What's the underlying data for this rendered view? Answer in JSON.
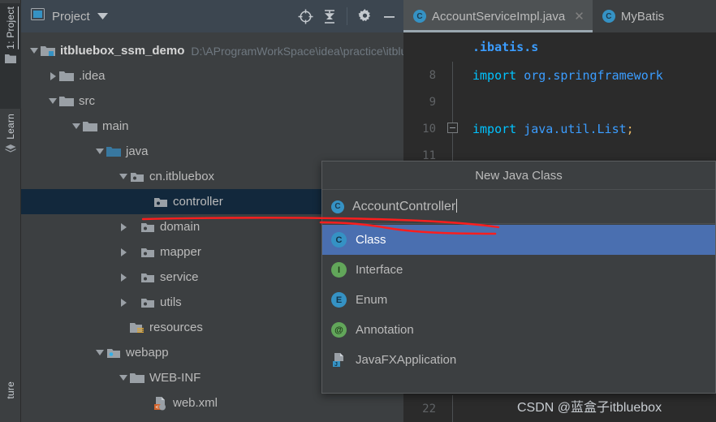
{
  "tool_strip": {
    "tabs": [
      {
        "label": "1: Project",
        "icon": "project-folder-icon"
      },
      {
        "label": "Learn",
        "icon": "learn-book-icon"
      },
      {
        "label": "ture",
        "icon": "structure-icon"
      }
    ]
  },
  "panel": {
    "title": "Project",
    "dropdown_icon": "chevron-down-icon",
    "window_icon": "project-window-icon",
    "actions": [
      {
        "name": "locate-icon",
        "tooltip": "Select Opened File"
      },
      {
        "name": "collapse-all-icon",
        "tooltip": "Collapse All"
      },
      {
        "name": "gear-icon",
        "tooltip": "Settings"
      },
      {
        "name": "minimize-icon",
        "tooltip": "Hide"
      }
    ]
  },
  "tree": {
    "rows": [
      {
        "label": "itbluebox_ssm_demo",
        "path": "D:\\AProgramWorkSpace\\idea\\practice\\itbluebox_ssm_demo",
        "indent": 0,
        "arrow": "down",
        "icon": "module-folder-icon",
        "bold": true,
        "selected": false
      },
      {
        "label": ".idea",
        "path": "",
        "indent": 1,
        "arrow": "right",
        "icon": "folder-icon",
        "bold": false,
        "selected": false
      },
      {
        "label": "src",
        "path": "",
        "indent": 1,
        "arrow": "down",
        "icon": "folder-icon",
        "bold": false,
        "selected": false
      },
      {
        "label": "main",
        "path": "",
        "indent": 2,
        "arrow": "down",
        "icon": "folder-icon",
        "bold": false,
        "selected": false
      },
      {
        "label": "java",
        "path": "",
        "indent": 3,
        "arrow": "down",
        "icon": "source-root-folder-icon",
        "bold": false,
        "selected": false
      },
      {
        "label": "cn.itbluebox",
        "path": "",
        "indent": 4,
        "arrow": "down",
        "icon": "package-folder-icon",
        "bold": false,
        "selected": false
      },
      {
        "label": "controller",
        "path": "",
        "indent": 5,
        "arrow": "none",
        "icon": "package-folder-icon",
        "bold": false,
        "selected": true
      },
      {
        "label": "domain",
        "path": "",
        "indent": 5,
        "arrow": "right",
        "icon": "package-folder-icon",
        "bold": false,
        "selected": false
      },
      {
        "label": "mapper",
        "path": "",
        "indent": 5,
        "arrow": "right",
        "icon": "package-folder-icon",
        "bold": false,
        "selected": false
      },
      {
        "label": "service",
        "path": "",
        "indent": 5,
        "arrow": "right",
        "icon": "package-folder-icon",
        "bold": false,
        "selected": false
      },
      {
        "label": "utils",
        "path": "",
        "indent": 5,
        "arrow": "right",
        "icon": "package-folder-icon",
        "bold": false,
        "selected": false
      },
      {
        "label": "resources",
        "path": "",
        "indent": 4,
        "arrow": "none",
        "icon": "resources-folder-icon",
        "bold": false,
        "selected": false
      },
      {
        "label": "webapp",
        "path": "",
        "indent": 3,
        "arrow": "down",
        "icon": "webapp-folder-icon",
        "bold": false,
        "selected": false
      },
      {
        "label": "WEB-INF",
        "path": "",
        "indent": 4,
        "arrow": "down",
        "icon": "folder-icon",
        "bold": false,
        "selected": false
      },
      {
        "label": "web.xml",
        "path": "",
        "indent": 5,
        "arrow": "none",
        "icon": "xml-file-icon",
        "bold": false,
        "selected": false
      }
    ]
  },
  "editor": {
    "tabs": [
      {
        "label": "AccountServiceImpl.java",
        "icon": "java-class-icon",
        "active": true,
        "closable": true
      },
      {
        "label": "MyBatis",
        "icon": "java-class-icon",
        "active": false,
        "closable": false
      }
    ],
    "partial_top_line": ".ibatis.s",
    "lines": [
      {
        "number": "8",
        "fold": false,
        "code_kw": "import",
        "code_pkg": " org.springframework",
        "code_end": ""
      },
      {
        "number": "9",
        "fold": false,
        "code_kw": "",
        "code_pkg": "",
        "code_end": ""
      },
      {
        "number": "10",
        "fold": true,
        "code_kw": "import",
        "code_pkg": " java.util.List",
        "code_end": ";"
      },
      {
        "number": "11",
        "fold": false,
        "code_kw": "",
        "code_pkg": "",
        "code_end": ""
      },
      {
        "number": "22",
        "fold": false,
        "code_kw": "",
        "code_pkg": "",
        "code_end": ""
      }
    ],
    "watermark": "CSDN @蓝盒子itbluebox"
  },
  "popup": {
    "title": "New Java Class",
    "input_value": "AccountController",
    "input_icon": "java-class-icon",
    "items": [
      {
        "label": "Class",
        "icon": "class-badge-icon",
        "badge": "C",
        "badge_class": "cls",
        "selected": true
      },
      {
        "label": "Interface",
        "icon": "interface-badge-icon",
        "badge": "I",
        "badge_class": "iface",
        "selected": false
      },
      {
        "label": "Enum",
        "icon": "enum-badge-icon",
        "badge": "E",
        "badge_class": "enm",
        "selected": false
      },
      {
        "label": "Annotation",
        "icon": "annotation-badge-icon",
        "badge": "@",
        "badge_class": "ann",
        "selected": false
      },
      {
        "label": "JavaFXApplication",
        "icon": "javafx-file-icon",
        "badge": "",
        "badge_class": "",
        "selected": false
      }
    ]
  },
  "colors": {
    "background": "#3c3f41",
    "editor_background": "#2b2b2b",
    "header": "#3c4650",
    "tree_selection": "#12283c",
    "list_selection": "#4a6fb0",
    "accent_blue": "#3592c4",
    "green": "#62a65a",
    "annotation_red": "#ff0000",
    "text": "#bbbbbb",
    "muted_text": "#6f7880"
  }
}
